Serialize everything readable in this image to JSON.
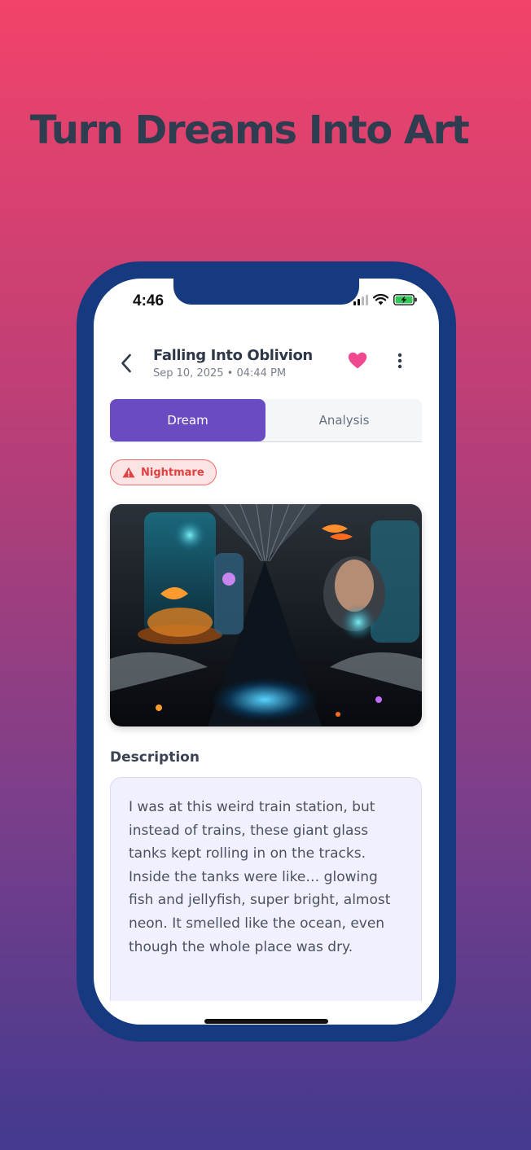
{
  "headline": "Turn Dreams Into Art",
  "status_bar": {
    "time": "4:46"
  },
  "header": {
    "title": "Falling Into Oblivion",
    "subtitle": "Sep 10, 2025 • 04:44 PM",
    "favorited": true
  },
  "tabs": [
    {
      "label": "Dream",
      "active": true
    },
    {
      "label": "Analysis",
      "active": false
    }
  ],
  "badge": {
    "label": "Nightmare",
    "icon": "warning-icon"
  },
  "description": {
    "heading": "Description",
    "text": "I was at this weird train station, but instead of trains, these giant glass tanks kept rolling in on the tracks. Inside the tanks were like… glowing fish and jellyfish, super bright, almost neon. It smelled like the ocean, even though the whole place was dry."
  },
  "colors": {
    "accent": "#6a4bc2",
    "heart": "#ef4a8f",
    "nightmare": "#e24141",
    "phone_frame": "#153a80"
  }
}
